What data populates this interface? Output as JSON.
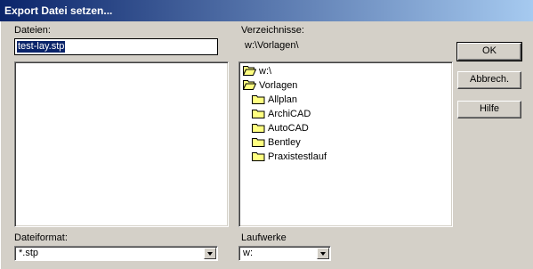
{
  "window": {
    "title": "Export Datei setzen..."
  },
  "files": {
    "label": "Dateien:",
    "filename_value": "test-lay.stp"
  },
  "directories": {
    "label": "Verzeichnisse:",
    "current_path": "w:\\Vorlagen\\",
    "tree": [
      {
        "label": "w:\\",
        "icon": "open-folder-icon"
      },
      {
        "label": "Vorlagen",
        "icon": "open-folder-icon"
      },
      {
        "label": "Allplan",
        "icon": "folder-icon"
      },
      {
        "label": "ArchiCAD",
        "icon": "folder-icon"
      },
      {
        "label": "AutoCAD",
        "icon": "folder-icon"
      },
      {
        "label": "Bentley",
        "icon": "folder-icon"
      },
      {
        "label": "Praxistestlauf",
        "icon": "folder-icon"
      }
    ]
  },
  "buttons": {
    "ok": "OK",
    "cancel": "Abbrech.",
    "help": "Hilfe"
  },
  "format": {
    "label": "Dateiformat:",
    "selected": "*.stp"
  },
  "drives": {
    "label": "Laufwerke",
    "selected": "w:"
  },
  "colors": {
    "title_start": "#0a246a",
    "title_end": "#a6caf0",
    "dialog_bg": "#d4d0c8",
    "folder_yellow": "#ffff80"
  }
}
